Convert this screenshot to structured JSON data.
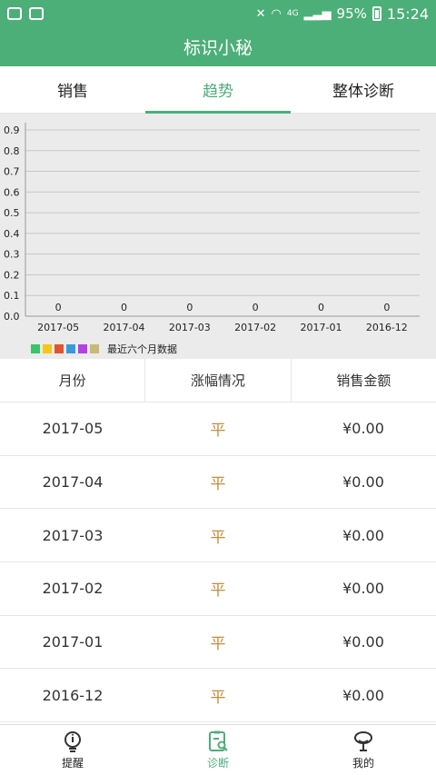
{
  "status_bar": {
    "battery": "95%",
    "time": "15:24",
    "network": "4G",
    "left_icons": [
      "chat-icon",
      "image-icon"
    ],
    "right_icons": [
      "mute-icon",
      "wifi-icon",
      "signal-icon",
      "battery-icon"
    ]
  },
  "app": {
    "title": "标识小秘",
    "theme_color": "#4caf78"
  },
  "tabs": [
    {
      "label": "销售",
      "active": false
    },
    {
      "label": "趋势",
      "active": true
    },
    {
      "label": "整体诊断",
      "active": false
    }
  ],
  "chart_data": {
    "type": "bar",
    "categories": [
      "2017-05",
      "2017-04",
      "2017-03",
      "2017-02",
      "2017-01",
      "2016-12"
    ],
    "values": [
      0,
      0,
      0,
      0,
      0,
      0
    ],
    "data_labels": [
      "0",
      "0",
      "0",
      "0",
      "0",
      "0"
    ],
    "y_ticks": [
      "0.0",
      "0.1",
      "0.2",
      "0.3",
      "0.4",
      "0.5",
      "0.6",
      "0.7",
      "0.8",
      "0.9"
    ],
    "ylim": [
      0,
      0.9
    ],
    "grid": true,
    "legend": {
      "label": "最近六个月数据",
      "placement": "bottom-left",
      "colors": [
        "#3cc46a",
        "#f5c518",
        "#e0552e",
        "#3a9ad9",
        "#b142e0",
        "#c9b977"
      ]
    }
  },
  "table": {
    "headers": [
      "月份",
      "涨幅情况",
      "销售金额"
    ],
    "rows": [
      {
        "month": "2017-05",
        "change": "平",
        "amount": "¥0.00"
      },
      {
        "month": "2017-04",
        "change": "平",
        "amount": "¥0.00"
      },
      {
        "month": "2017-03",
        "change": "平",
        "amount": "¥0.00"
      },
      {
        "month": "2017-02",
        "change": "平",
        "amount": "¥0.00"
      },
      {
        "month": "2017-01",
        "change": "平",
        "amount": "¥0.00"
      },
      {
        "month": "2016-12",
        "change": "平",
        "amount": "¥0.00"
      }
    ]
  },
  "bottom_nav": [
    {
      "label": "提醒",
      "icon": "bulb-info-icon",
      "active": false
    },
    {
      "label": "诊断",
      "icon": "diagnosis-clipboard-icon",
      "active": true
    },
    {
      "label": "我的",
      "icon": "profile-icon",
      "active": false
    }
  ]
}
